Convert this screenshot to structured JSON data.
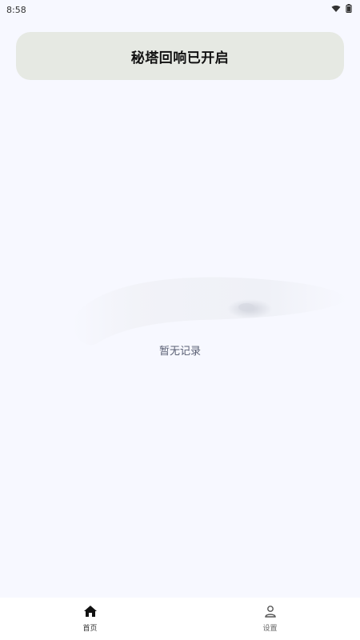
{
  "status_bar": {
    "time": "8:58",
    "icons": [
      "wifi-icon",
      "battery-icon"
    ]
  },
  "banner": {
    "text": "秘塔回响已开启"
  },
  "empty_state": {
    "text": "暂无记录"
  },
  "bottom_nav": {
    "items": [
      {
        "label": "首页",
        "icon": "home-icon",
        "active": true
      },
      {
        "label": "设置",
        "icon": "user-icon",
        "active": false
      }
    ]
  },
  "colors": {
    "background": "#f7f8ff",
    "banner_bg": "#e6e9e3",
    "text_primary": "#111111",
    "text_muted": "#5a5f73"
  }
}
